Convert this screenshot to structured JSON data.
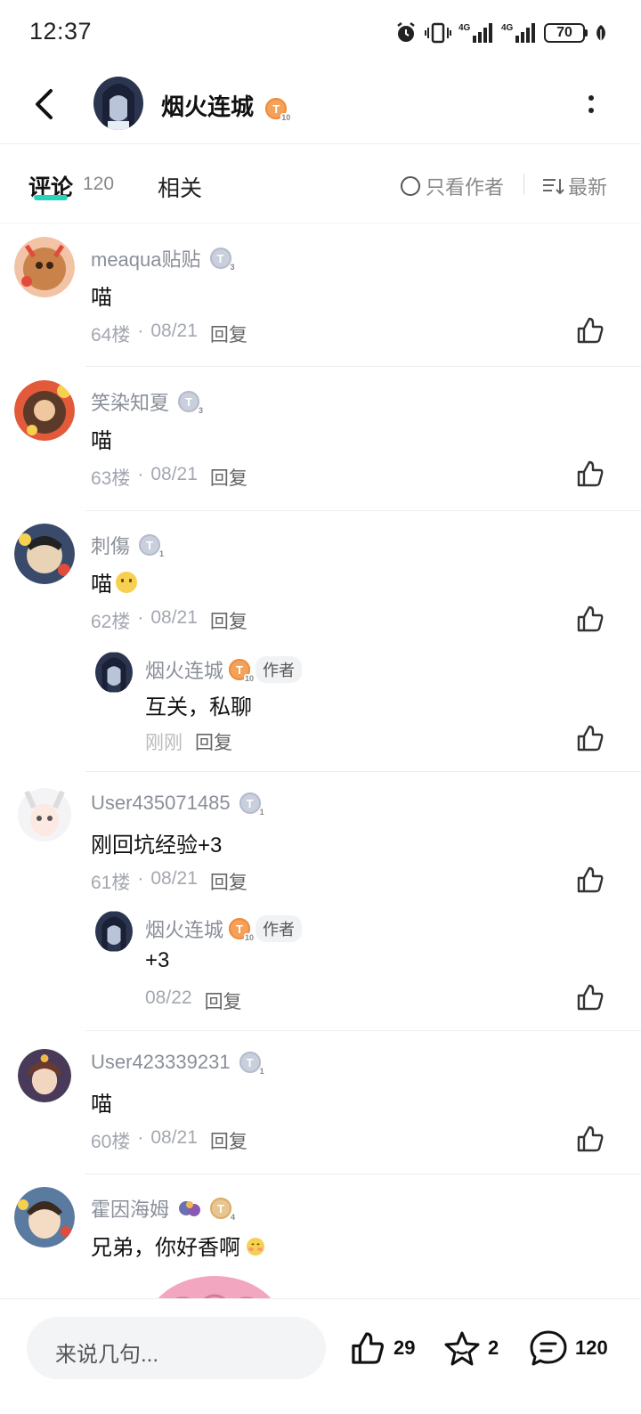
{
  "status_bar": {
    "time": "12:37",
    "battery": "70",
    "icons": [
      "alarm-icon",
      "vibrate-icon",
      "signal-4g-icon",
      "signal-4g-icon",
      "battery-icon",
      "leaf-icon"
    ]
  },
  "header": {
    "title": "烟火连城",
    "level": "T",
    "level_sub": "10"
  },
  "tabs": {
    "comments_label": "评论",
    "comments_count": "120",
    "related_label": "相关",
    "author_only_label": "只看作者",
    "sort_label": "最新"
  },
  "comments": [
    {
      "name": "meaqua贴贴",
      "level": "T",
      "level_sub": "3",
      "text": "喵",
      "floor": "64楼",
      "date": "08/21",
      "reply_label": "回复"
    },
    {
      "name": "笑染知夏",
      "level": "T",
      "level_sub": "3",
      "text": "喵",
      "floor": "63楼",
      "date": "08/21",
      "reply_label": "回复"
    },
    {
      "name": "刺傷",
      "level": "T",
      "level_sub": "1",
      "text": "喵",
      "floor": "62楼",
      "date": "08/21",
      "reply_label": "回复",
      "reply": {
        "name": "烟火连城",
        "level": "T",
        "level_sub": "10",
        "author_tag": "作者",
        "text": "互关，私聊",
        "time": "刚刚",
        "reply_label": "回复"
      }
    },
    {
      "name": "User435071485",
      "level": "T",
      "level_sub": "1",
      "text": "刚回坑经验+3",
      "floor": "61楼",
      "date": "08/21",
      "reply_label": "回复",
      "reply": {
        "name": "烟火连城",
        "level": "T",
        "level_sub": "10",
        "author_tag": "作者",
        "text": "+3",
        "time": "08/22",
        "reply_label": "回复"
      }
    },
    {
      "name": "User423339231",
      "level": "T",
      "level_sub": "1",
      "text": "喵",
      "floor": "60楼",
      "date": "08/21",
      "reply_label": "回复"
    },
    {
      "name": "霍因海姆",
      "level": "T",
      "level_sub": "4",
      "text": "兄弟，你好香啊"
    }
  ],
  "bottom_bar": {
    "input_placeholder": "来说几句...",
    "likes": "29",
    "favorites": "2",
    "comments": "120"
  },
  "colors": {
    "accent": "#2ad1bd",
    "level_orange": "#f4a15a",
    "level_gray": "#c9cfdc"
  }
}
